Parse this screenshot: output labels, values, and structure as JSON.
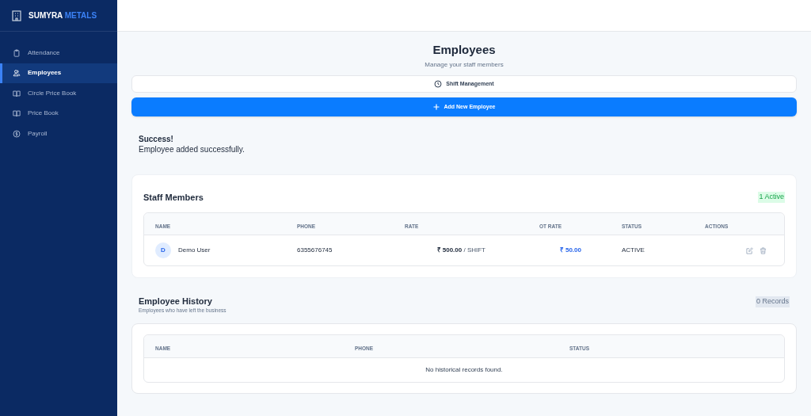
{
  "brand": {
    "name": "SUMYRA",
    "accent": "METALS"
  },
  "sidebar": {
    "items": [
      {
        "label": "Attendance",
        "selected": false
      },
      {
        "label": "Employees",
        "selected": true
      },
      {
        "label": "Circle Price Book",
        "selected": false
      },
      {
        "label": "Price Book",
        "selected": false
      },
      {
        "label": "Payroll",
        "selected": false
      }
    ]
  },
  "page": {
    "title": "Employees",
    "subtitle": "Manage your staff members"
  },
  "buttons": {
    "shift": "Shift Management",
    "add": "Add New Employee"
  },
  "alert": {
    "title": "Success!",
    "message": "Employee added successfully."
  },
  "staff": {
    "title": "Staff Members",
    "badge": "1 Active",
    "columns": [
      "NAME",
      "PHONE",
      "RATE",
      "OT RATE",
      "STATUS",
      "ACTIONS"
    ],
    "rows": [
      {
        "initial": "D",
        "name": "Demo User",
        "phone": "6355676745",
        "rate": "**₹ 500.00** / SHIFT",
        "ot_rate": "₹ 50.00",
        "status": "ACTIVE"
      }
    ]
  },
  "history": {
    "title": "Employee History",
    "subtitle": "Employees who have left the business",
    "badge": "0 Records",
    "columns": [
      "NAME",
      "PHONE",
      "STATUS"
    ],
    "empty": "No historical records found."
  }
}
